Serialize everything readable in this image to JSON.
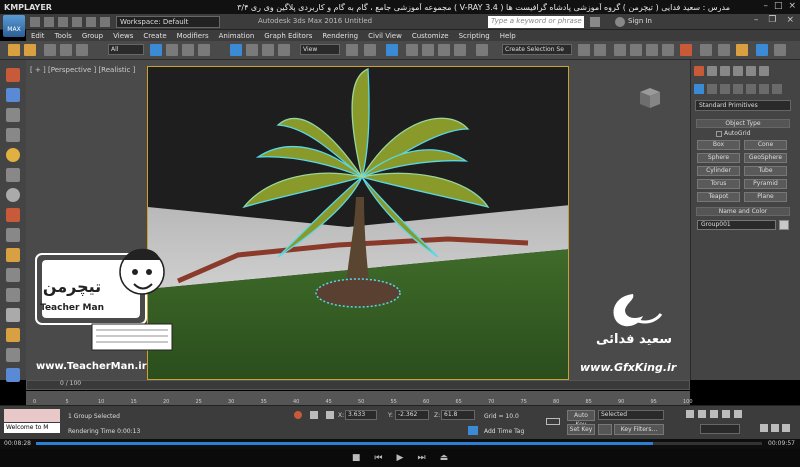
{
  "player": {
    "name": "KMPLAYER",
    "title": "مجموعه آموزشی جامع ، گام به گام و کاربردی پلاگین وی ری ۳/۴  ( V-RAY 3.4 )  مدرس : سعید فدایی ( تیچرمن ) گروه آموزشی پادشاه گرافیست ها",
    "time_current": "00:08:28",
    "time_total": "00:09:57",
    "progress": 0.85
  },
  "app": {
    "logo": "MAX",
    "workspace": "Workspace: Default",
    "title": "Autodesk 3ds Max 2016    Untitled",
    "search_placeholder": "Type a keyword or phrase",
    "sign_in": "Sign In"
  },
  "menu": [
    "Edit",
    "Tools",
    "Group",
    "Views",
    "Create",
    "Modifiers",
    "Animation",
    "Graph Editors",
    "Rendering",
    "Civil View",
    "Customize",
    "Scripting",
    "Help"
  ],
  "toolbar": {
    "filter": "All",
    "ref_coord": "View",
    "selection_set": "Create Selection Se"
  },
  "viewport": {
    "label": "[ + ] [Perspective ] [Realistic ]"
  },
  "watermarks": {
    "teacherman_logo_text": "تیچرمن",
    "teacherman_brand": "Teacher Man",
    "teacherman_url": "www.TeacherMan.ir",
    "gfxking_name": "سعید فدائی",
    "gfxking_url": "www.GfxKing.ir"
  },
  "command_panel": {
    "category": "Standard Primitives",
    "object_type_title": "Object Type",
    "autogrid": "AutoGrid",
    "primitives": [
      "Box",
      "Cone",
      "Sphere",
      "GeoSphere",
      "Cylinder",
      "Tube",
      "Torus",
      "Pyramid",
      "Teapot",
      "Plane"
    ],
    "name_color_title": "Name and Color",
    "object_name": "Group001"
  },
  "timeline": {
    "frame": "0 / 100",
    "ticks": [
      "0",
      "5",
      "10",
      "15",
      "20",
      "25",
      "30",
      "35",
      "40",
      "45",
      "50",
      "55",
      "60",
      "65",
      "70",
      "75",
      "80",
      "85",
      "90",
      "95",
      "100"
    ]
  },
  "status": {
    "maxscript": "Welcome to M",
    "selection": "1 Group Selected",
    "rendering_time": "Rendering Time  0:00:13",
    "x_label": "X:",
    "x_value": "3.633",
    "y_label": "Y:",
    "y_value": "-2.362",
    "z_label": "Z:",
    "z_value": "61.8",
    "grid": "Grid = 10.0",
    "add_time_tag": "Add Time Tag",
    "auto_key": "Auto Key",
    "set_key": "Set Key",
    "key_mode": "Selected",
    "key_filters": "Key Filters..."
  }
}
